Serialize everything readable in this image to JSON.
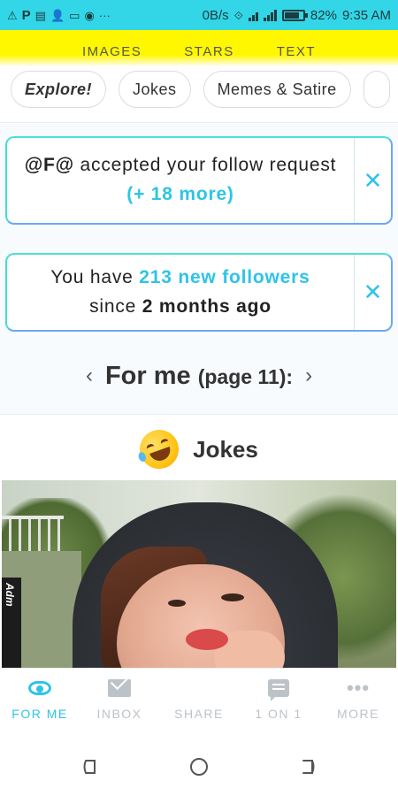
{
  "status_bar": {
    "net_speed": "0B/s",
    "battery": "82%",
    "battery_level": 0.82,
    "time": "9:35 AM"
  },
  "top_tabs": [
    "IMAGES",
    "STARS",
    "TEXT"
  ],
  "chips": [
    "Explore!",
    "Jokes",
    "Memes & Satire"
  ],
  "notifications": {
    "follow": {
      "user": "@F@",
      "text": " accepted your follow request ",
      "more": "(+ 18 more)"
    },
    "followers": {
      "prefix": "You have ",
      "count": "213 new followers",
      "middle": " since ",
      "time": "2 months ago"
    }
  },
  "pager": {
    "title": "For me",
    "page": "(page 11):"
  },
  "section": {
    "title": "Jokes"
  },
  "photo": {
    "tag": "Adm"
  },
  "bottom_nav": [
    {
      "label": "FOR ME",
      "icon": "eye-icon",
      "active": true
    },
    {
      "label": "INBOX",
      "icon": "mail-icon",
      "active": false
    },
    {
      "label": "SHARE",
      "icon": "plus-circle-icon",
      "active": false
    },
    {
      "label": "1 ON 1",
      "icon": "chat-icon",
      "active": false
    },
    {
      "label": "MORE",
      "icon": "more-dots-icon",
      "active": false
    }
  ],
  "colors": {
    "accent": "#2ec4e6",
    "status_bar": "#33d6e6",
    "top_tabs_bg": "#fff700",
    "inactive": "#bcc3c8"
  }
}
